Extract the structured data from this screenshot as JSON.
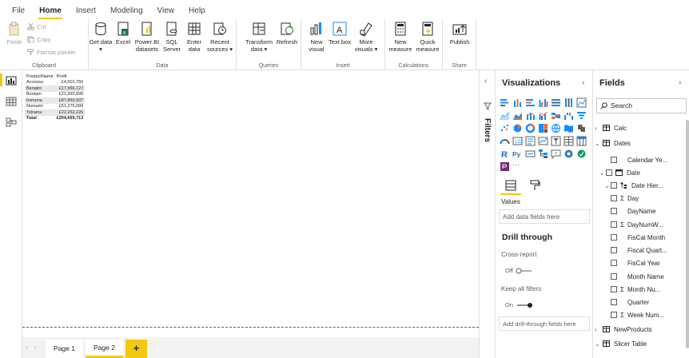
{
  "ribbon_tabs": [
    "File",
    "Home",
    "Insert",
    "Modeling",
    "View",
    "Help"
  ],
  "clipboard": {
    "paste": "Paste",
    "cut": "Cut",
    "copy": "Copy",
    "format_painter": "Format painter",
    "label": "Clipboard"
  },
  "data_group": {
    "label": "Data",
    "buttons": [
      "Get data ▾",
      "Excel",
      "Power BI datasets",
      "SQL Server",
      "Enter data",
      "Recent sources ▾"
    ]
  },
  "queries_group": {
    "label": "Queries",
    "buttons": [
      "Transform data ▾",
      "Refresh"
    ]
  },
  "insert_group": {
    "label": "Insert",
    "buttons": [
      "New visual",
      "Text box",
      "More visuals ▾"
    ]
  },
  "calc_group": {
    "label": "Calculations",
    "buttons": [
      "New measure",
      "Quick measure"
    ]
  },
  "share_group": {
    "label": "Share",
    "buttons": [
      "Publish"
    ]
  },
  "table": {
    "headers": [
      "ProductName",
      "Profit"
    ],
    "rows": [
      [
        "Accessa",
        "£4,501,750"
      ],
      [
        "Benatrn",
        "£17,966,127"
      ],
      [
        "Bonlam",
        "£21,392,695"
      ],
      [
        "Imnuma",
        "£87,860,507"
      ],
      [
        "Numamr",
        "£51,275,099"
      ],
      [
        "Tstramu",
        "£22,262,226"
      ]
    ],
    "total": [
      "Total",
      "£204,669,713"
    ]
  },
  "pages": [
    "Page 1",
    "Page 2"
  ],
  "add_page": "+",
  "filters_label": "Filters",
  "visualizations": {
    "title": "Visualizations",
    "values_label": "Values",
    "values_placeholder": "Add data fields here",
    "drill_title": "Drill through",
    "cross_report": "Cross-report",
    "cross_state": "Off",
    "keep_filters": "Keep all filters",
    "keep_state": "On",
    "drill_placeholder": "Add drill-through fields here"
  },
  "fields": {
    "title": "Fields",
    "search_placeholder": "Search",
    "items": [
      {
        "label": "Calc",
        "kind": "table",
        "expand": "›"
      },
      {
        "label": "Dates",
        "kind": "table",
        "expand": "⌄"
      },
      {
        "label": "Calendar Ye...",
        "kind": "field",
        "sigma": ""
      },
      {
        "label": "Date",
        "kind": "datefield",
        "expand": "⌄"
      },
      {
        "label": "Date Hier...",
        "kind": "hier",
        "expand": "⌄"
      },
      {
        "label": "Day",
        "kind": "field",
        "sigma": "Σ"
      },
      {
        "label": "DayName",
        "kind": "field",
        "sigma": ""
      },
      {
        "label": "DayNumW...",
        "kind": "field",
        "sigma": "Σ"
      },
      {
        "label": "FisCal Month",
        "kind": "field",
        "sigma": ""
      },
      {
        "label": "Fiscal Quart...",
        "kind": "field",
        "sigma": ""
      },
      {
        "label": "FisCal Year",
        "kind": "field",
        "sigma": ""
      },
      {
        "label": "Month Name",
        "kind": "field",
        "sigma": ""
      },
      {
        "label": "Month Nu...",
        "kind": "field",
        "sigma": "Σ"
      },
      {
        "label": "Quarter",
        "kind": "field",
        "sigma": ""
      },
      {
        "label": "Week Num...",
        "kind": "field",
        "sigma": "Σ"
      },
      {
        "label": "NewProducts",
        "kind": "table",
        "expand": "›"
      },
      {
        "label": "Slicer Table",
        "kind": "table",
        "expand": "⌄"
      }
    ]
  },
  "colors": {
    "accent": "#f2c811",
    "ribbon_bg": "#ffffff",
    "pane_bg": "#f3f2f1"
  }
}
